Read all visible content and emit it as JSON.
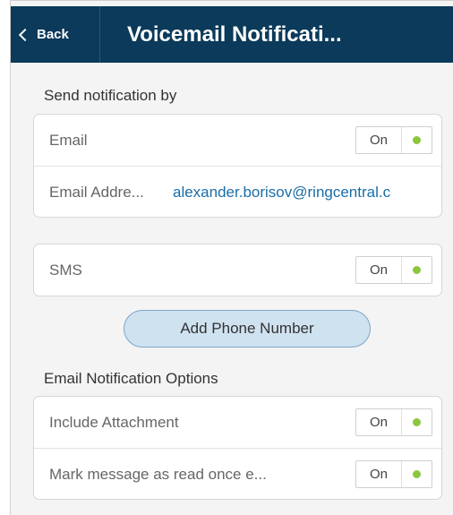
{
  "header": {
    "back_label": "Back",
    "title": "Voicemail Notificati..."
  },
  "send_section": {
    "title": "Send notification by"
  },
  "email_card": {
    "email_label": "Email",
    "email_toggle": "On",
    "address_label": "Email Addre...",
    "address_value": "alexander.borisov@ringcentral.c"
  },
  "sms_card": {
    "sms_label": "SMS",
    "sms_toggle": "On"
  },
  "add_phone_label": "Add Phone Number",
  "options_section": {
    "title": "Email Notification Options",
    "include_attachment_label": "Include Attachment",
    "include_attachment_toggle": "On",
    "mark_read_label": "Mark message as read once e...",
    "mark_read_toggle": "On"
  },
  "colors": {
    "header_bg": "#0b3a5a",
    "toggle_on_dot": "#8cc63f",
    "link": "#1a6da6",
    "button_bg": "#cfe2f0"
  }
}
